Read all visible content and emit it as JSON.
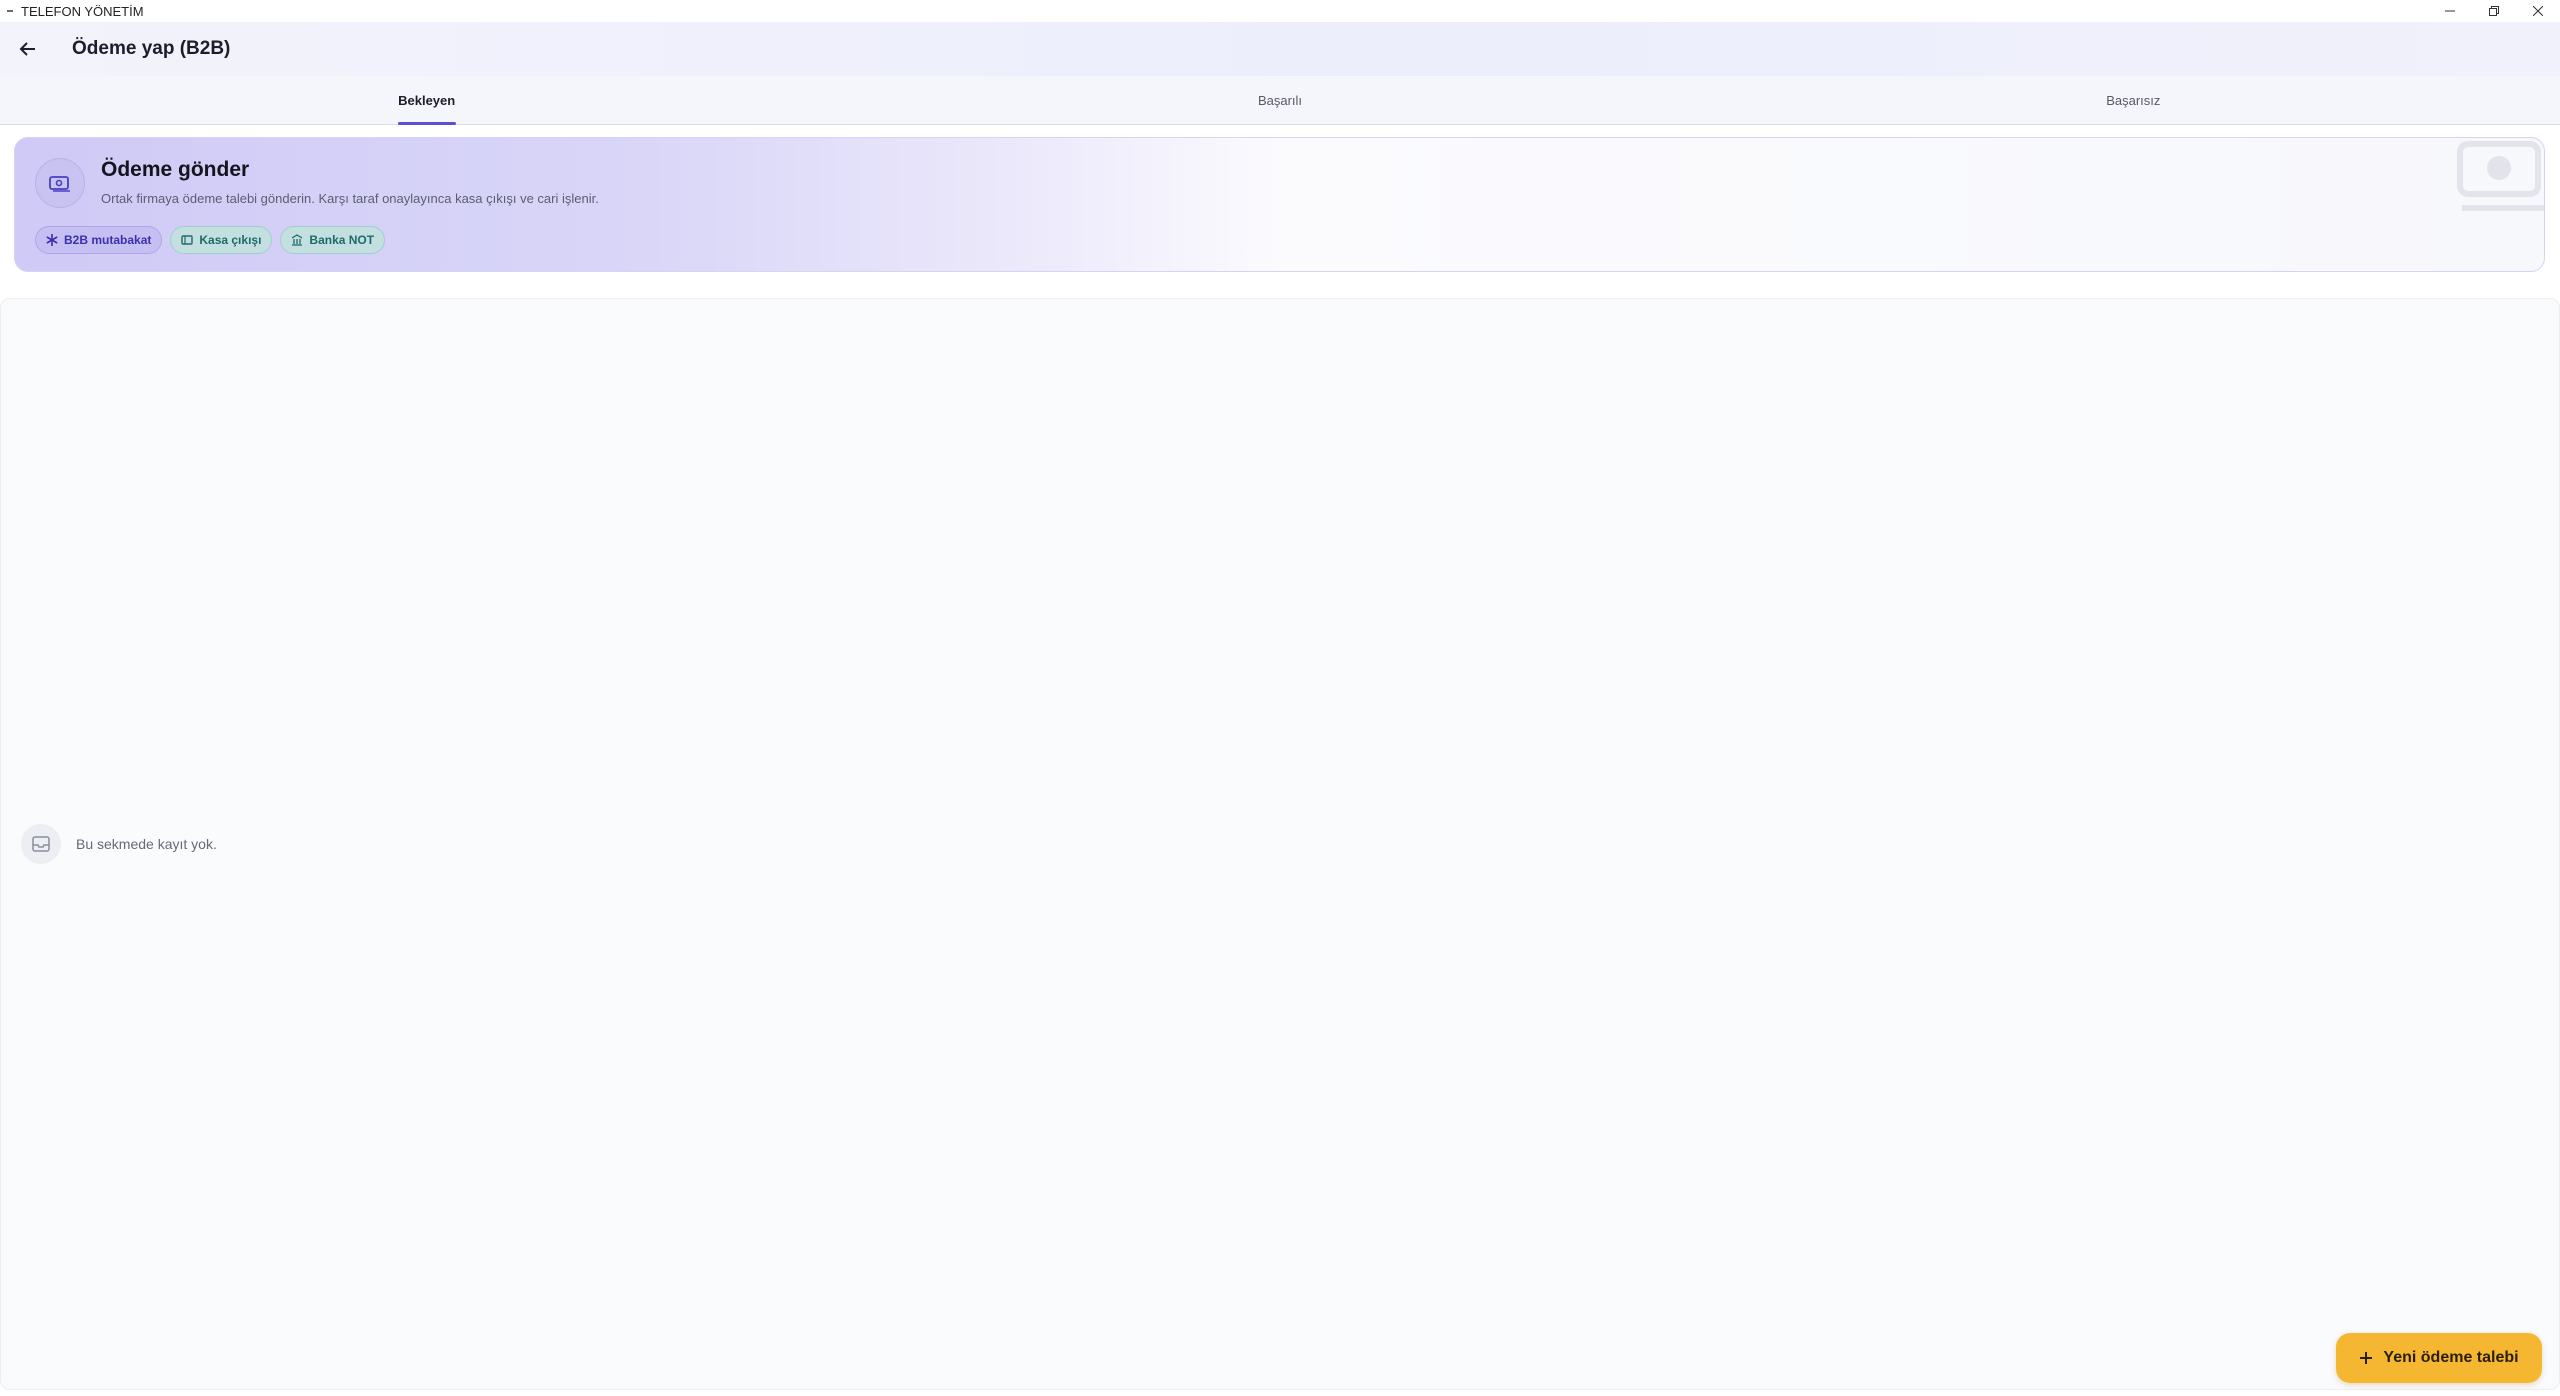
{
  "window": {
    "title": "TELEFON YÖNETİM"
  },
  "appbar": {
    "title": "Ödeme yap (B2B)"
  },
  "tabs": [
    {
      "label": "Bekleyen",
      "active": true
    },
    {
      "label": "Başarılı",
      "active": false
    },
    {
      "label": "Başarısız",
      "active": false
    }
  ],
  "banner": {
    "title": "Ödeme gönder",
    "description": "Ortak firmaya ödeme talebi gönderin. Karşı taraf onaylayınca kasa çıkışı ve cari işlenir.",
    "chips": [
      {
        "label": "B2B mutabakat",
        "icon": "asterisk-icon"
      },
      {
        "label": "Kasa çıkışı",
        "icon": "cash-icon"
      },
      {
        "label": "Banka NOT",
        "icon": "bank-icon"
      }
    ]
  },
  "empty_state": {
    "text": "Bu sekmede kayıt yok.",
    "icon": "inbox-icon"
  },
  "fab": {
    "label": "Yeni ödeme talebi",
    "icon": "plus-icon"
  },
  "colors": {
    "accent": "#5b4fd6",
    "fab": "#f5b732",
    "chip_purple": "#c6c0f2",
    "chip_teal": "#c3dfe0"
  }
}
